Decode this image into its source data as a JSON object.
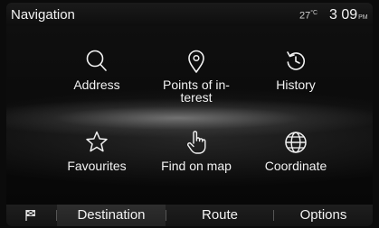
{
  "header": {
    "title": "Navigation",
    "temperature": "27",
    "temperature_unit": "°C",
    "time": "3 09",
    "ampm": "PM"
  },
  "menu": {
    "items": [
      {
        "label": "Address",
        "icon": "search-icon"
      },
      {
        "label": "Points of in-\nterest",
        "icon": "location-pin-icon"
      },
      {
        "label": "History",
        "icon": "history-icon"
      },
      {
        "label": "Favourites",
        "icon": "star-icon"
      },
      {
        "label": "Find on map",
        "icon": "pointing-hand-icon"
      },
      {
        "label": "Coordinate",
        "icon": "globe-icon"
      }
    ]
  },
  "tabs": {
    "flag_icon": "checkered-flag-icon",
    "items": [
      {
        "label": "Destination",
        "active": true
      },
      {
        "label": "Route",
        "active": false
      },
      {
        "label": "Options",
        "active": false
      }
    ]
  },
  "colors": {
    "text": "#f2f2f2",
    "background": "#0b0b0b",
    "active_tab": "#2e2e2e"
  }
}
